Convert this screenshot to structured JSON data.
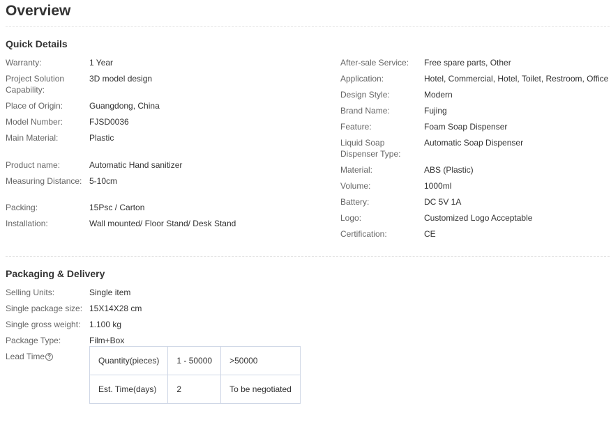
{
  "page_title": "Overview",
  "quick_details": {
    "title": "Quick Details",
    "left": [
      {
        "label": "Warranty:",
        "value": "1 Year"
      },
      {
        "label": "Project Solution Capability:",
        "value": "3D model design"
      },
      {
        "label": "Place of Origin:",
        "value": "Guangdong, China"
      },
      {
        "label": "Model Number:",
        "value": "FJSD0036"
      },
      {
        "label": "Main Material:",
        "value": "Plastic"
      },
      {
        "label": "Product name:",
        "value": "Automatic Hand sanitizer"
      },
      {
        "label": "Measuring Distance:",
        "value": "5-10cm"
      },
      {
        "label": "Packing:",
        "value": "15Psc / Carton"
      },
      {
        "label": "Installation:",
        "value": "Wall mounted/ Floor Stand/ Desk Stand"
      }
    ],
    "right": [
      {
        "label": "After-sale Service:",
        "value": "Free spare parts, Other"
      },
      {
        "label": "Application:",
        "value": "Hotel, Commercial, Hotel, Toilet, Restroom, Office"
      },
      {
        "label": "Design Style:",
        "value": "Modern"
      },
      {
        "label": "Brand Name:",
        "value": "Fujing"
      },
      {
        "label": "Feature:",
        "value": "Foam Soap Dispenser"
      },
      {
        "label": "Liquid Soap Dispenser Type:",
        "value": "Automatic Soap Dispenser"
      },
      {
        "label": "Material:",
        "value": "ABS (Plastic)"
      },
      {
        "label": "Volume:",
        "value": "1000ml"
      },
      {
        "label": "Battery:",
        "value": "DC 5V 1A"
      },
      {
        "label": "Logo:",
        "value": "Customized Logo Acceptable"
      },
      {
        "label": "Certification:",
        "value": "CE"
      }
    ]
  },
  "packaging": {
    "title": "Packaging & Delivery",
    "rows": [
      {
        "label": "Selling Units:",
        "value": "Single item"
      },
      {
        "label": "Single package size:",
        "value": "15X14X28 cm"
      },
      {
        "label": "Single gross weight:",
        "value": "1.100 kg"
      },
      {
        "label": "Package Type:",
        "value": "Film+Box"
      }
    ],
    "lead_time": {
      "label": "Lead Time",
      "help_icon": "question-circle-icon",
      "help_glyph": "?",
      "table": [
        [
          "Quantity(pieces)",
          "1 - 50000",
          ">50000"
        ],
        [
          "Est. Time(days)",
          "2",
          "To be negotiated"
        ]
      ]
    }
  }
}
